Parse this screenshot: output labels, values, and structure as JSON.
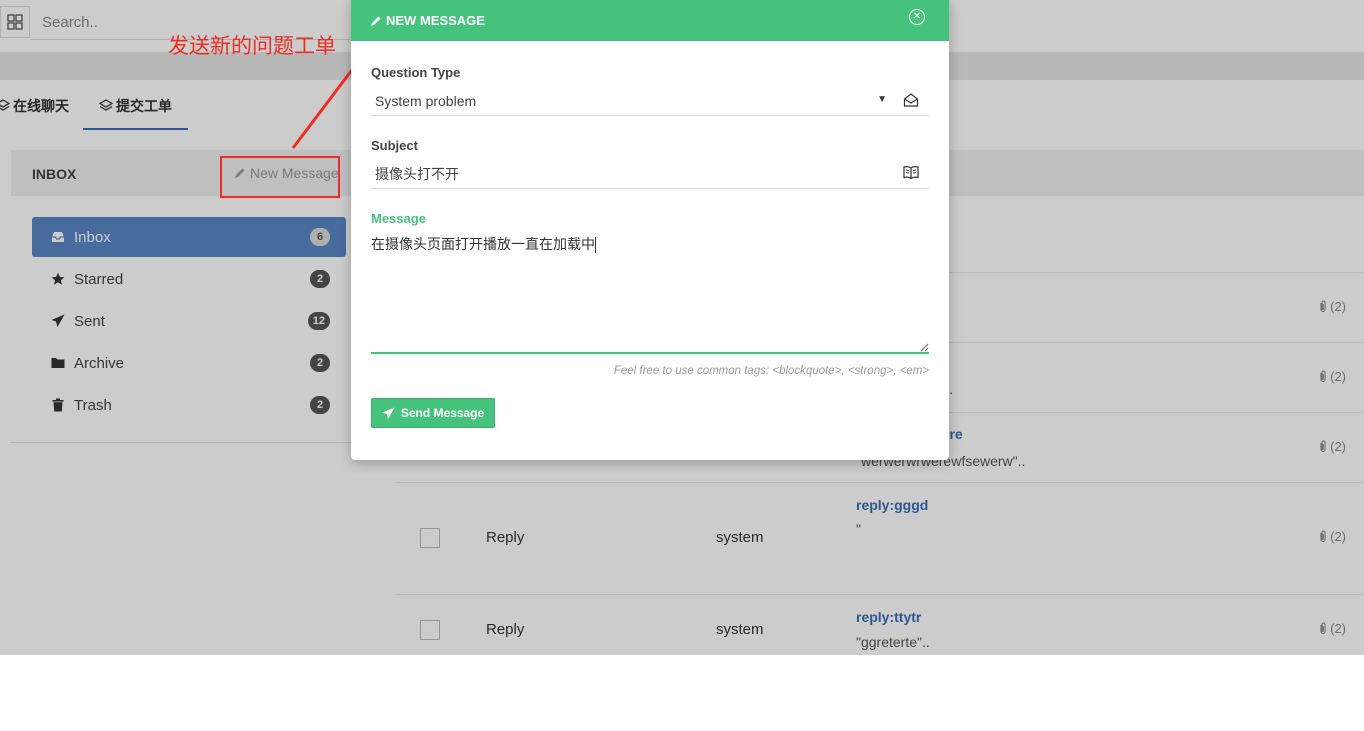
{
  "search": {
    "placeholder": "Search.."
  },
  "tabs": [
    {
      "label": "在线聊天"
    },
    {
      "label": "提交工单"
    }
  ],
  "inbox": {
    "title": "INBOX",
    "new_message_label": "New Message"
  },
  "nav": [
    {
      "label": "Inbox",
      "count": "6",
      "icon": "inbox-icon"
    },
    {
      "label": "Starred",
      "count": "2",
      "icon": "star-icon"
    },
    {
      "label": "Sent",
      "count": "12",
      "icon": "paper-plane-icon"
    },
    {
      "label": "Archive",
      "count": "2",
      "icon": "folder-icon"
    },
    {
      "label": "Trash",
      "count": "2",
      "icon": "trash-icon"
    }
  ],
  "rows": [
    {
      "label": "",
      "from": "",
      "subject": "",
      "preview": "",
      "attach": "(2)"
    },
    {
      "label": "",
      "from": "",
      "subject": "",
      "preview": "er\"..",
      "attach": "(2)"
    },
    {
      "label": "",
      "from": "",
      "subject": "rre",
      "preview": "\"werwerwrwerewfsewerw\"..",
      "attach": "(2)"
    },
    {
      "label": "Reply",
      "from": "system",
      "subject": "reply:gggd",
      "preview": "\"",
      "attach": "(2)"
    },
    {
      "label": "Reply",
      "from": "system",
      "subject": "reply:ttytr",
      "preview": "\"ggreterte\"..",
      "attach": "(2)"
    }
  ],
  "annotation": {
    "text": "发送新的问题工单"
  },
  "modal": {
    "title": "NEW MESSAGE",
    "question_type_label": "Question Type",
    "question_type_value": "System problem",
    "subject_label": "Subject",
    "subject_value": "摄像头打不开",
    "message_label": "Message",
    "message_value": "在摄像头页面打开播放一直在加载中",
    "hint": "Feel free to use common tags: <blockquote>, <strong>, <em>",
    "send_label": "Send Message"
  },
  "colors": {
    "accent": "#45c37c",
    "nav_active": "#5a86c5",
    "link": "#3a6db5",
    "annotation": "#ee2e24"
  }
}
